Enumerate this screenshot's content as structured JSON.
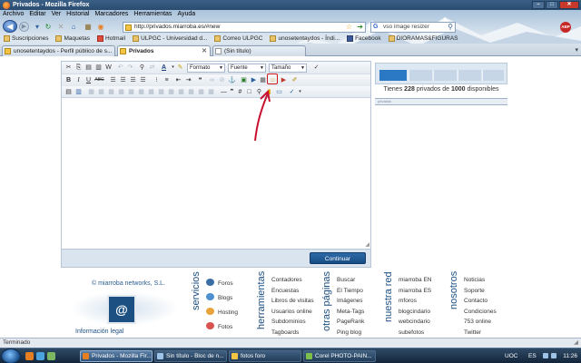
{
  "window": {
    "title": "Privados - Mozilla Firefox"
  },
  "menu": [
    "Archivo",
    "Editar",
    "Ver",
    "Historial",
    "Marcadores",
    "Herramientas",
    "Ayuda"
  ],
  "nav": {
    "url": "http://privados.miarroba.es/#new",
    "search_text": "vso image resizer",
    "search_engine": "G",
    "abp_label": "ABP"
  },
  "bookmarks": [
    "Suscripciones",
    "Maquetas",
    "Hotmail",
    "ULPGC - Universidad d...",
    "Correo ULPGC",
    "unosetentaydos - Índi...",
    "Facebook",
    "DIORAMAS&FIGURAS"
  ],
  "tabs": [
    {
      "label": "unosetentaydos - Perfil público de s...",
      "active": false
    },
    {
      "label": "Privados",
      "active": true
    },
    {
      "label": "(Sin título)",
      "active": false
    }
  ],
  "editor": {
    "selects": {
      "format": "Formato",
      "font": "Fuente",
      "size": "Tamaño"
    },
    "toolbar_glyphs": {
      "bold": "B",
      "italic": "I",
      "underline": "U",
      "strike": "ABC",
      "hash": "#",
      "text_color": "A"
    },
    "submit_label": "Continuar",
    "highlighted_button_icon": "smiley-icon"
  },
  "quota": {
    "prefix": "Tienes",
    "used": "228",
    "middle": "privados de",
    "total": "1000",
    "suffix": "disponibles",
    "fraction_used": 0.228
  },
  "panel_bar_label": "privados",
  "footer": {
    "brand": "© miarroba networks, S.L.",
    "logo_glyph": "@",
    "legal": "Información legal",
    "servicios": {
      "title": "servicios",
      "items": [
        "Foros",
        "Blogs",
        "Hosting",
        "Fotos"
      ]
    },
    "herramientas": {
      "title": "herramientas",
      "items": [
        "Contadores",
        "Encuestas",
        "Libros de visitas",
        "Usuarios online",
        "Subdominios",
        "Tagboards"
      ]
    },
    "otras": {
      "title": "otras páginas",
      "items": [
        "Buscar",
        "El Tiempo",
        "Imágenes",
        "Meta-Tags",
        "PageRank",
        "Ping blog"
      ]
    },
    "red": {
      "title": "nuestra red",
      "items": [
        "miarroba EN",
        "miarroba ES",
        "mforos",
        "blogcindario",
        "webcindario",
        "subefotos"
      ]
    },
    "nosotros": {
      "title": "nosotros",
      "items": [
        "Noticias",
        "Soporte",
        "Contacto",
        "Condiciones",
        "753 online",
        "Twitter"
      ]
    }
  },
  "status": {
    "text": "Terminado"
  },
  "taskbar": {
    "items": [
      {
        "label": "Privados - Mozilla Fir...",
        "active": true
      },
      {
        "label": "Sin título - Bloc de n...",
        "active": false
      },
      {
        "label": "fotos foro",
        "active": false
      },
      {
        "label": "Corel PHOTO-PAIN...",
        "active": false
      }
    ],
    "tray_label": "UOC",
    "lang": "ES",
    "clock": "11:26"
  },
  "colors": {
    "accent": "#1c4f82",
    "highlight_red": "#d01818",
    "button_blue": "#174d85"
  }
}
